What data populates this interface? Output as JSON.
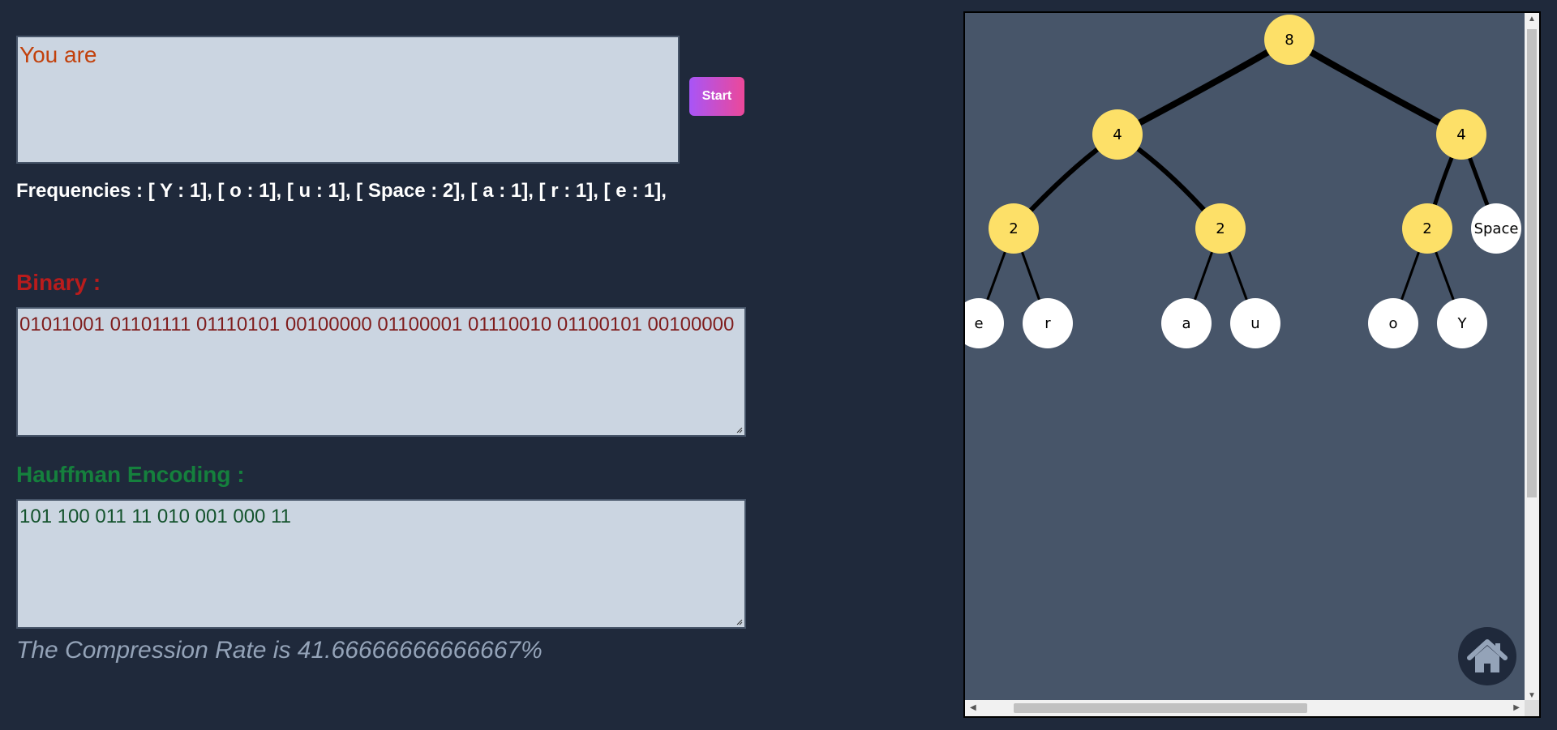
{
  "input": {
    "value": "You are"
  },
  "start_label": "Start",
  "frequencies": "Frequencies : [ Y : 1], [ o : 1], [ u : 1], [ Space : 2], [ a : 1], [ r : 1], [ e : 1],",
  "binary": {
    "heading": "Binary :",
    "value": "01011001 01101111 01110101 00100000 01100001 01110010 01100101 00100000"
  },
  "huffman": {
    "heading": "Hauffman Encoding :",
    "value": "101 100 011 11 010 001 000 11"
  },
  "compression_rate": "The Compression Rate is 41.66666666666667%",
  "tree": {
    "internal_color": "#fde068",
    "leaf_color": "#ffffff",
    "root": "8",
    "level1": [
      "4",
      "4"
    ],
    "level2": [
      "2",
      "2",
      "2",
      "Space"
    ],
    "leaves": [
      "e",
      "r",
      "a",
      "u",
      "o",
      "Y"
    ]
  },
  "home_icon": "home-icon"
}
